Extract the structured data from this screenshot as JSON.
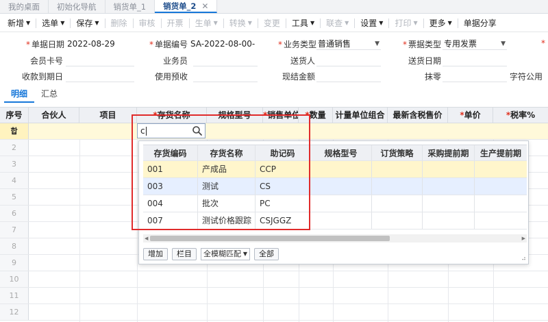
{
  "tabs": [
    {
      "label": "我的桌面"
    },
    {
      "label": "初始化导航"
    },
    {
      "label": "销货单_1"
    },
    {
      "label": "销货单_2",
      "close": "✕"
    }
  ],
  "toolbar": {
    "new": "新增",
    "select": "选单",
    "save": "保存",
    "delete": "删除",
    "audit": "审核",
    "invoice": "开票",
    "generate": "生单",
    "convert": "转换",
    "change": "变更",
    "tools": "工具",
    "link": "联查",
    "settings": "设置",
    "print": "打印",
    "more": "更多",
    "share": "单据分享"
  },
  "form": {
    "doc_date_label": "单据日期",
    "doc_date": "2022-08-29",
    "doc_no_label": "单据编号",
    "doc_no": "SA-2022-08-00-0...",
    "biz_type_label": "业务类型",
    "biz_type": "普通销售",
    "invoice_type_label": "票据类型",
    "invoice_type": "专用发票",
    "member_label": "会员卡号",
    "salesman_label": "业务员",
    "deliverer_label": "送货人",
    "delivery_date_label": "送货日期",
    "due_date_label": "收款到期日",
    "prepay_label": "使用预收",
    "cash_label": "现结金额",
    "writeoff_label": "抹零",
    "char_label": "字符公用"
  },
  "subtabs": {
    "detail": "明细",
    "summary": "汇总"
  },
  "grid": {
    "headers": {
      "seq": "序号",
      "partner": "合伙人",
      "project": "项目",
      "item_name": "存货名称",
      "spec": "规格型号",
      "unit": "销售单位",
      "qty": "数量",
      "unit_group": "计量单位组合",
      "latest_price": "最新含税售价",
      "price": "单价",
      "tax_rate": "税率%"
    },
    "active_marker": "합",
    "row_numbers": [
      "2",
      "3",
      "4",
      "5",
      "6",
      "7",
      "8",
      "9",
      "10",
      "11",
      "12"
    ]
  },
  "search": {
    "value": "c"
  },
  "popup": {
    "headers": {
      "code": "存货编码",
      "name": "存货名称",
      "mnemonic": "助记码",
      "spec": "规格型号",
      "order_policy": "订货策略",
      "purchase_lead": "采购提前期",
      "production_lead": "生产提前期"
    },
    "rows": [
      {
        "code": "001",
        "name": "产成品",
        "mnemonic": "CCP"
      },
      {
        "code": "003",
        "name": "测试",
        "mnemonic": "CS"
      },
      {
        "code": "004",
        "name": "批次",
        "mnemonic": "PC"
      },
      {
        "code": "007",
        "name": "测试价格跟踪",
        "mnemonic": "CSJGGZ"
      }
    ],
    "add_label": "增加",
    "columns_label": "栏目",
    "match_mode": "全模糊匹配",
    "all_label": "全部"
  },
  "colors": {
    "accent": "#1677d9",
    "highlight_box": "#e02a2a",
    "active_row": "#fff9da"
  }
}
